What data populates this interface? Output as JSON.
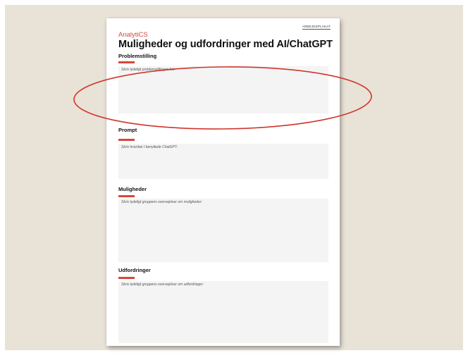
{
  "sheet": {
    "tag": "ARBEJDSPLAKAT",
    "brand": "AnalytiCS",
    "title": "Muligheder og udfordringer med AI/ChatGPT",
    "sections": [
      {
        "label": "Problemstilling",
        "placeholder": "Skriv tydeligt problemstillingen her:"
      },
      {
        "label": "Prompt",
        "placeholder": "Skriv hvordan I benyttede ChatGPT:"
      },
      {
        "label": "Muligheder",
        "placeholder": "Skriv tydeligt gruppens overvejelser om muligheder:"
      },
      {
        "label": "Udfordringer",
        "placeholder": "Skriv tydeligt gruppens overvejelser om udfordringer:"
      }
    ]
  },
  "colors": {
    "accent": "#d8453a",
    "annotation": "#d0362c",
    "backdrop": "#e9e2d7"
  }
}
